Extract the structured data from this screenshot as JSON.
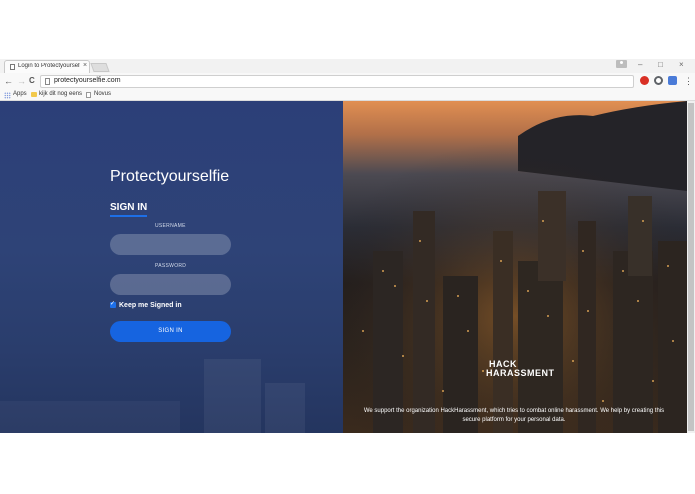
{
  "browser": {
    "tab_title": "Login to Protectyourselfie",
    "tab_close": "×",
    "address": "protectyourselfie.com",
    "window_controls": {
      "minimize": "–",
      "maximize": "□",
      "close": "×"
    },
    "nav": {
      "back": "←",
      "forward": "→",
      "reload": "C"
    },
    "menu": "⋮",
    "bookmarks": [
      {
        "label": "Apps",
        "icon": "apps-grid-icon"
      },
      {
        "label": "kijk dit nog eens",
        "icon": "folder-icon"
      },
      {
        "label": "Novus",
        "icon": "page-icon"
      }
    ],
    "colors": {
      "ext1": "#d93025",
      "ext2": "#5f6368",
      "ext3": "#4a7bd8"
    }
  },
  "login": {
    "title": "Protectyourselfie",
    "heading": "SIGN IN",
    "username_label": "USERNAME",
    "username_value": "",
    "password_label": "PASSWORD",
    "password_value": "",
    "keep_signed_in": "Keep me Signed in",
    "keep_signed_in_checked": true,
    "signin_button": "SIGN IN"
  },
  "promo": {
    "logo_line1": "HACK",
    "logo_line2": "HARASSMENT",
    "description": "We support the organization HackHarassment, which tries to combat online harassment. We help by creating this secure platform for your personal data."
  },
  "colors": {
    "panel": "#2e4377",
    "accent": "#1664e0"
  }
}
